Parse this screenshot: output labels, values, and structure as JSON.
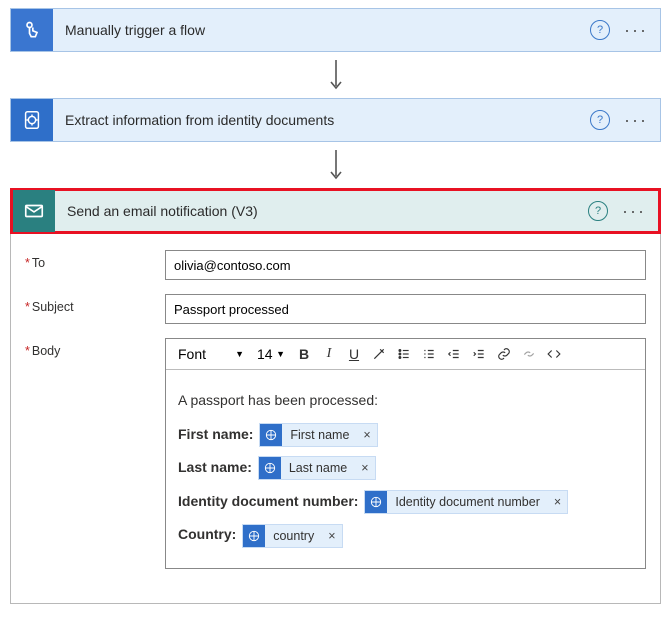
{
  "steps": {
    "trigger": {
      "title": "Manually trigger a flow"
    },
    "extract": {
      "title": "Extract information from identity documents"
    },
    "email": {
      "title": "Send an email notification (V3)"
    }
  },
  "fields": {
    "to": {
      "label": "To",
      "value": "olivia@contoso.com"
    },
    "subject": {
      "label": "Subject",
      "value": "Passport processed"
    },
    "body": {
      "label": "Body"
    }
  },
  "toolbar": {
    "font_label": "Font",
    "size_label": "14"
  },
  "body_content": {
    "intro": "A passport has been processed:",
    "lines": [
      {
        "label": "First name:",
        "token": "First name"
      },
      {
        "label": "Last name:",
        "token": "Last name"
      },
      {
        "label": "Identity document number:",
        "token": "Identity document number"
      },
      {
        "label": "Country:",
        "token": "country"
      }
    ]
  }
}
